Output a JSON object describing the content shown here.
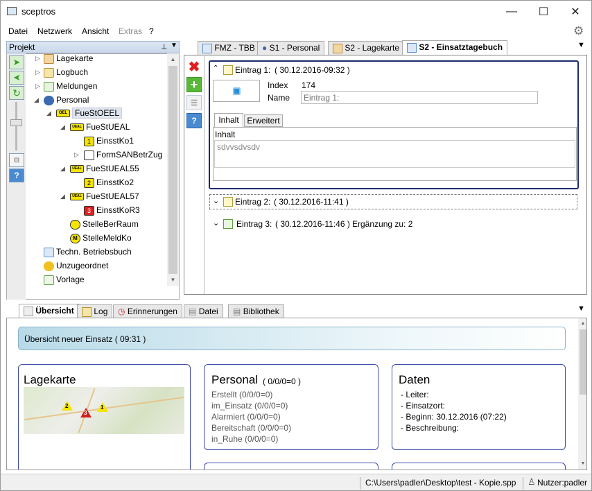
{
  "app": {
    "title": "sceptros"
  },
  "menu": [
    "Datei",
    "Netzwerk",
    "Ansicht",
    "Extras",
    "?"
  ],
  "project": {
    "header": "Projekt",
    "pin": "⊥"
  },
  "tree": [
    {
      "label": "Lagekarte",
      "icon": "map-icon",
      "color": "#e8a030"
    },
    {
      "label": "Logbuch",
      "icon": "lock-icon",
      "color": "#d8b040"
    },
    {
      "label": "Meldungen",
      "icon": "message-icon",
      "color": "#5aa040"
    },
    {
      "label": "Personal",
      "icon": "people-icon",
      "color": "#3a6ab0"
    },
    {
      "label": "FueStOEEL",
      "icon": "badge-icon",
      "color": "#f5e400"
    },
    {
      "label": "FueStUEAL",
      "icon": "badge-icon",
      "color": "#f5e400"
    },
    {
      "label": "EinsstKo1",
      "icon": "number-1-icon",
      "color": "#f5e400"
    },
    {
      "label": "FormSANBetrZug",
      "icon": "formation-icon",
      "color": "#ffffff"
    },
    {
      "label": "FueStUEAL55",
      "icon": "badge-icon",
      "color": "#f5e400"
    },
    {
      "label": "EinsstKo2",
      "icon": "number-2-icon",
      "color": "#f5e400"
    },
    {
      "label": "FueStUEAL57",
      "icon": "badge-icon",
      "color": "#f5e400"
    },
    {
      "label": "EinsstKoR3",
      "icon": "number-3-icon",
      "color": "#e02020"
    },
    {
      "label": "StelleBerRaum",
      "icon": "circle-icon",
      "color": "#f5e400"
    },
    {
      "label": "StelleMeldKo",
      "icon": "m-icon",
      "color": "#f5e400"
    },
    {
      "label": "Techn. Betriebsbuch",
      "icon": "book-icon",
      "color": "#5a90d0"
    },
    {
      "label": "Unzugeordnet",
      "icon": "coin-icon",
      "color": "#f0c020"
    },
    {
      "label": "Vorlage",
      "icon": "template-icon",
      "color": "#5aa040"
    }
  ],
  "badges": {
    "oel": "OEL",
    "ual": "UEAL"
  },
  "tabs_top": [
    "FMZ - TBB",
    "S1 - Personal",
    "S2 - Lagekarte",
    "S2 - Einsatztagebuch"
  ],
  "entries": {
    "e1": {
      "title": "Eintrag 1:",
      "time": "( 30.12.2016-09:32 )",
      "index_label": "Index",
      "index_value": "174",
      "name_label": "Name",
      "name_placeholder": "Eintrag 1:",
      "tab_inhalt": "Inhalt",
      "tab_erweitert": "Erweitert",
      "inhalt_label": "Inhalt",
      "inhalt_text": "sdvvsdvsdv"
    },
    "e2": {
      "title": "Eintrag 2:",
      "time": "( 30.12.2016-11:41 )"
    },
    "e3": {
      "title": "Eintrag 3:",
      "time": "( 30.12.2016-11:46 )",
      "extra": "Ergänzung zu: 2"
    }
  },
  "tabs_bottom": [
    "Übersicht",
    "Log",
    "Erinnerungen",
    "Datei",
    "Bibliothek"
  ],
  "overview": {
    "banner": "Übersicht neuer Einsatz  ( 09:31 )",
    "lagekarte": {
      "title": "Lagekarte",
      "markers": [
        "2",
        "3",
        "1"
      ]
    },
    "personal": {
      "title": "Personal",
      "count": "( 0/0/0=0 )",
      "rows": [
        "Erstellt (0/0/0=0)",
        "im_Einsatz (0/0/0=0)",
        "Alarmiert (0/0/0=0)",
        "Bereitschaft (0/0/0=0)",
        "in_Ruhe (0/0/0=0)"
      ]
    },
    "daten": {
      "title": "Daten",
      "rows": [
        "- Leiter:",
        "- Einsatzort:",
        "- Beginn:  30.12.2016 (07:22)",
        "- Beschreibung:"
      ]
    }
  },
  "status": {
    "path": "C:\\Users\\padler\\Desktop\\test - Kopie.spp",
    "user": "Nutzer:padler"
  }
}
